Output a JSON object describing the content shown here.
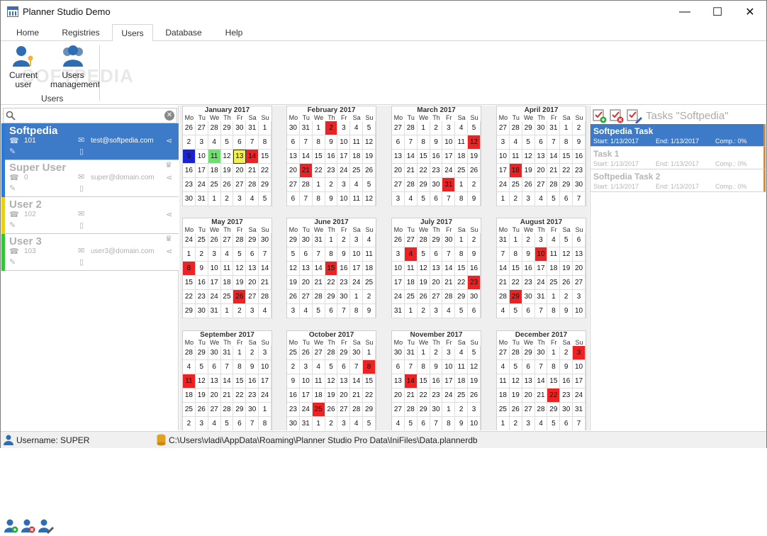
{
  "window": {
    "title": "Planner Studio Demo",
    "minimize": "—",
    "maximize": "☐",
    "close": "✕"
  },
  "tabs": [
    "Home",
    "Registries",
    "Users",
    "Database",
    "Help"
  ],
  "ribbon": {
    "current_user": "Current\nuser",
    "users_management": "Users\nmanagement",
    "group_label": "Users",
    "watermark": "SOFTPEDIA"
  },
  "users": [
    {
      "name": "Softpedia",
      "id": "101",
      "email": "test@softpedia.com",
      "color": "#2a7ad6",
      "selected": true
    },
    {
      "name": "Super User",
      "id": "0",
      "email": "super@domain.com",
      "color": "#2a7ad6",
      "selected": false
    },
    {
      "name": "User 2",
      "id": "102",
      "email": "",
      "color": "#e8d020",
      "selected": false
    },
    {
      "name": "User 3",
      "id": "103",
      "email": "user3@domain.com",
      "color": "#3ac33a",
      "selected": false
    }
  ],
  "weekdays": [
    "Mo",
    "Tu",
    "We",
    "Th",
    "Fr",
    "Sa",
    "Su"
  ],
  "months": [
    {
      "title": "January 2017",
      "days": [
        26,
        27,
        28,
        29,
        30,
        31,
        1,
        2,
        3,
        4,
        5,
        6,
        7,
        8,
        9,
        10,
        11,
        12,
        13,
        14,
        15,
        16,
        17,
        18,
        19,
        20,
        21,
        22,
        23,
        24,
        25,
        26,
        27,
        28,
        29,
        30,
        31,
        1,
        2,
        3,
        4,
        5
      ],
      "marks": {
        "14": "blue",
        "16": "green",
        "18": "yellow",
        "19": "red"
      }
    },
    {
      "title": "February 2017",
      "days": [
        30,
        31,
        1,
        2,
        3,
        4,
        5,
        6,
        7,
        8,
        9,
        10,
        11,
        12,
        13,
        14,
        15,
        16,
        17,
        18,
        19,
        20,
        21,
        22,
        23,
        24,
        25,
        26,
        27,
        28,
        1,
        2,
        3,
        4,
        5,
        6,
        7,
        8,
        9,
        10,
        11,
        12
      ],
      "marks": {
        "3": "red",
        "22": "red"
      }
    },
    {
      "title": "March 2017",
      "days": [
        27,
        28,
        1,
        2,
        3,
        4,
        5,
        6,
        7,
        8,
        9,
        10,
        11,
        12,
        13,
        14,
        15,
        16,
        17,
        18,
        19,
        20,
        21,
        22,
        23,
        24,
        25,
        26,
        27,
        28,
        29,
        30,
        31,
        1,
        2,
        3,
        4,
        5,
        6,
        7,
        8,
        9
      ],
      "marks": {
        "13": "red",
        "32": "red"
      }
    },
    {
      "title": "April 2017",
      "days": [
        27,
        28,
        29,
        30,
        31,
        1,
        2,
        3,
        4,
        5,
        6,
        7,
        8,
        9,
        10,
        11,
        12,
        13,
        14,
        15,
        16,
        17,
        18,
        19,
        20,
        21,
        22,
        23,
        24,
        25,
        26,
        27,
        28,
        29,
        30,
        1,
        2,
        3,
        4,
        5,
        6,
        7
      ],
      "marks": {
        "22": "red"
      }
    },
    {
      "title": "May 2017",
      "days": [
        24,
        25,
        26,
        27,
        28,
        29,
        30,
        1,
        2,
        3,
        4,
        5,
        6,
        7,
        8,
        9,
        10,
        11,
        12,
        13,
        14,
        15,
        16,
        17,
        18,
        19,
        20,
        21,
        22,
        23,
        24,
        25,
        26,
        27,
        28,
        29,
        30,
        31,
        1,
        2,
        3,
        4
      ],
      "marks": {
        "14": "red",
        "32": "red"
      }
    },
    {
      "title": "June 2017",
      "days": [
        29,
        30,
        31,
        1,
        2,
        3,
        4,
        5,
        6,
        7,
        8,
        9,
        10,
        11,
        12,
        13,
        14,
        15,
        16,
        17,
        18,
        19,
        20,
        21,
        22,
        23,
        24,
        25,
        26,
        27,
        28,
        29,
        30,
        1,
        2,
        3,
        4,
        5,
        6,
        7,
        8,
        9
      ],
      "marks": {
        "17": "red"
      }
    },
    {
      "title": "July 2017",
      "days": [
        26,
        27,
        28,
        29,
        30,
        1,
        2,
        3,
        4,
        5,
        6,
        7,
        8,
        9,
        10,
        11,
        12,
        13,
        14,
        15,
        16,
        17,
        18,
        19,
        20,
        21,
        22,
        23,
        24,
        25,
        26,
        27,
        28,
        29,
        30,
        31,
        1,
        2,
        3,
        4,
        5,
        6
      ],
      "marks": {
        "8": "red",
        "27": "red"
      }
    },
    {
      "title": "August 2017",
      "days": [
        31,
        1,
        2,
        3,
        4,
        5,
        6,
        7,
        8,
        9,
        10,
        11,
        12,
        13,
        14,
        15,
        16,
        17,
        18,
        19,
        20,
        21,
        22,
        23,
        24,
        25,
        26,
        27,
        28,
        29,
        30,
        31,
        1,
        2,
        3,
        4,
        5,
        6,
        7,
        8,
        9,
        10
      ],
      "marks": {
        "10": "red",
        "29": "red"
      }
    },
    {
      "title": "September 2017",
      "days": [
        28,
        29,
        30,
        31,
        1,
        2,
        3,
        4,
        5,
        6,
        7,
        8,
        9,
        10,
        11,
        12,
        13,
        14,
        15,
        16,
        17,
        18,
        19,
        20,
        21,
        22,
        23,
        24,
        25,
        26,
        27,
        28,
        29,
        30,
        1,
        2,
        3,
        4,
        5,
        6,
        7,
        8
      ],
      "marks": {
        "14": "red"
      }
    },
    {
      "title": "October 2017",
      "days": [
        25,
        26,
        27,
        28,
        29,
        30,
        1,
        2,
        3,
        4,
        5,
        6,
        7,
        8,
        9,
        10,
        11,
        12,
        13,
        14,
        15,
        16,
        17,
        18,
        19,
        20,
        21,
        22,
        23,
        24,
        25,
        26,
        27,
        28,
        29,
        30,
        31,
        1,
        2,
        3,
        4,
        5
      ],
      "marks": {
        "13": "red",
        "30": "red"
      }
    },
    {
      "title": "November 2017",
      "days": [
        30,
        31,
        1,
        2,
        3,
        4,
        5,
        6,
        7,
        8,
        9,
        10,
        11,
        12,
        13,
        14,
        15,
        16,
        17,
        18,
        19,
        20,
        21,
        22,
        23,
        24,
        25,
        26,
        27,
        28,
        29,
        30,
        1,
        2,
        3,
        4,
        5,
        6,
        7,
        8,
        9,
        10
      ],
      "marks": {
        "15": "red"
      }
    },
    {
      "title": "December 2017",
      "days": [
        27,
        28,
        29,
        30,
        1,
        2,
        3,
        4,
        5,
        6,
        7,
        8,
        9,
        10,
        11,
        12,
        13,
        14,
        15,
        16,
        17,
        18,
        19,
        20,
        21,
        22,
        23,
        24,
        25,
        26,
        27,
        28,
        29,
        30,
        31,
        1,
        2,
        3,
        4,
        5,
        6,
        7
      ],
      "marks": {
        "6": "red",
        "25": "red"
      }
    }
  ],
  "tasks_panel": {
    "title": "Tasks \"Softpedia\"",
    "tasks": [
      {
        "name": "Softpedia Task",
        "start": "Start: 1/13/2017",
        "end": "End: 1/13/2017",
        "comp": "Comp.: 0%",
        "selected": true
      },
      {
        "name": "Task 1",
        "start": "Start: 1/13/2017",
        "end": "End: 1/13/2017",
        "comp": "Comp.: 0%",
        "selected": false
      },
      {
        "name": "Softpedia Task 2",
        "start": "Start: 1/13/2017",
        "end": "End: 1/13/2017",
        "comp": "Comp.: 0%",
        "selected": false
      }
    ]
  },
  "status": {
    "username": "Username: SUPER",
    "path": "C:\\Users\\vladi\\AppData\\Roaming\\Planner Studio Pro Data\\IniFiles\\Data.plannerdb"
  },
  "colors": {
    "accent": "#3d7ac7",
    "mark_red": "#ee2222",
    "task_bar": "#e08a2a"
  }
}
